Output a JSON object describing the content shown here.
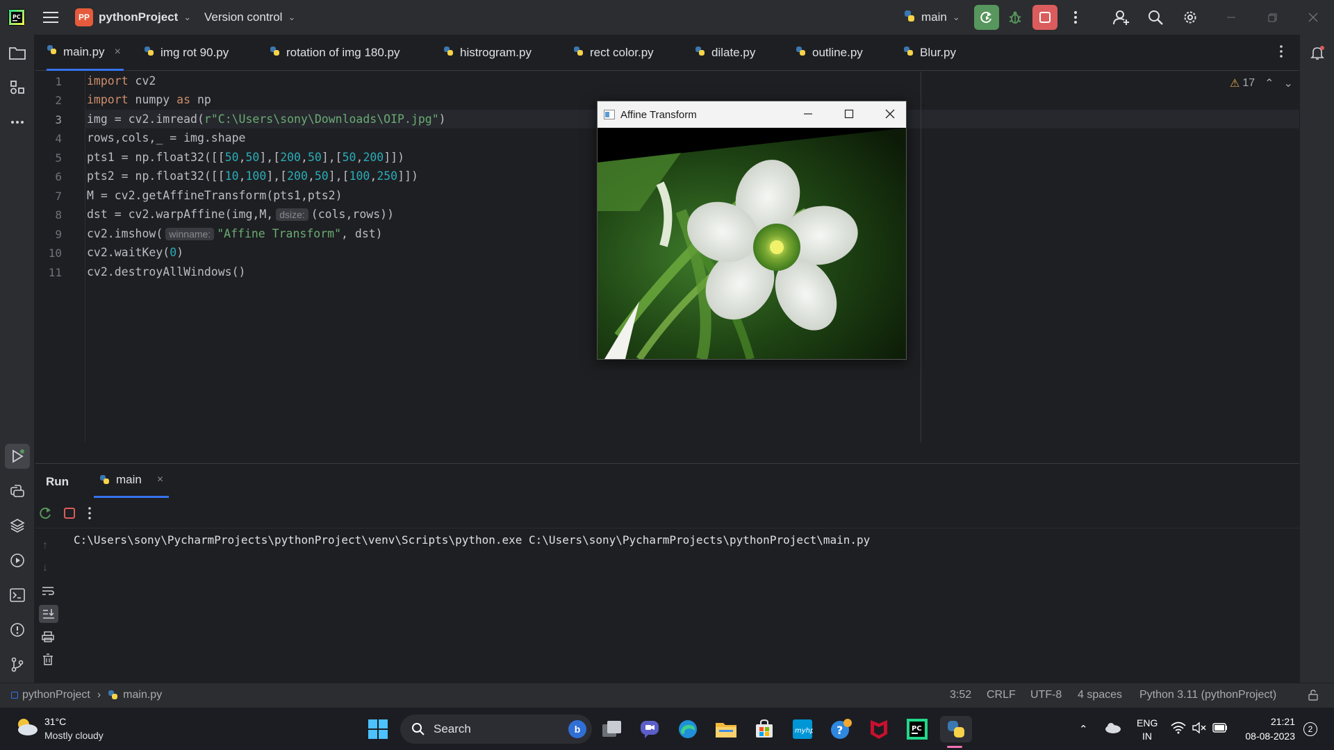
{
  "titlebar": {
    "project_badge": "PP",
    "project_name": "pythonProject",
    "vcs_label": "Version control",
    "branch": "main"
  },
  "tabs": [
    {
      "label": "main.py",
      "active": true
    },
    {
      "label": "img rot 90.py"
    },
    {
      "label": "rotation of img 180.py"
    },
    {
      "label": "histrogram.py"
    },
    {
      "label": "rect color.py"
    },
    {
      "label": "dilate.py"
    },
    {
      "label": "outline.py"
    },
    {
      "label": "Blur.py"
    }
  ],
  "editor": {
    "warnings_count": "17",
    "line_numbers": [
      "1",
      "2",
      "3",
      "4",
      "5",
      "6",
      "7",
      "8",
      "9",
      "10",
      "11"
    ],
    "hints": {
      "dsize": "dsize:",
      "winname": "winname:"
    }
  },
  "affine_window": {
    "title": "Affine Transform"
  },
  "run": {
    "tab_run": "Run",
    "tab_main": "main",
    "command": "C:\\Users\\sony\\PycharmProjects\\pythonProject\\venv\\Scripts\\python.exe C:\\Users\\sony\\PycharmProjects\\pythonProject\\main.py"
  },
  "statusbar": {
    "crumb_project": "pythonProject",
    "crumb_file": "main.py",
    "position": "3:52",
    "line_sep": "CRLF",
    "encoding": "UTF-8",
    "indent": "4 spaces",
    "interpreter": "Python 3.11 (pythonProject)"
  },
  "taskbar": {
    "weather_temp": "31°C",
    "weather_desc": "Mostly cloudy",
    "search_label": "Search",
    "lang_top": "ENG",
    "lang_bottom": "IN",
    "time": "21:21",
    "date": "08-08-2023",
    "notif_count": "2"
  },
  "colors": {
    "accent": "#3574f0",
    "run_green": "#57965c",
    "stop_red": "#db5c5c"
  }
}
